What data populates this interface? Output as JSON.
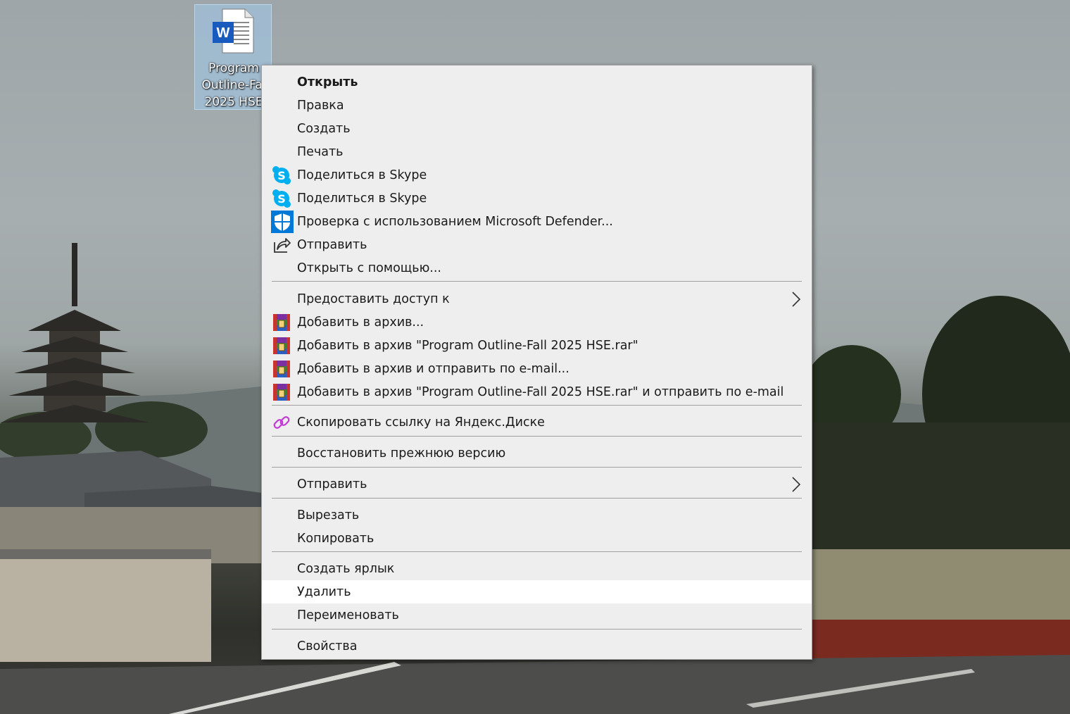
{
  "desktop_icon": {
    "label_lines": [
      "Program",
      "Outline-Fal",
      "2025 HSE"
    ],
    "type_icon": "word-document-icon"
  },
  "context_menu": {
    "items": [
      {
        "label": "Открыть",
        "icon": null,
        "bold": true
      },
      {
        "label": "Правка",
        "icon": null
      },
      {
        "label": "Создать",
        "icon": null
      },
      {
        "label": "Печать",
        "icon": null
      },
      {
        "label": "Поделиться в Skype",
        "icon": "skype-icon"
      },
      {
        "label": "Поделиться в Skype",
        "icon": "skype-icon"
      },
      {
        "label": "Проверка с использованием Microsoft Defender...",
        "icon": "defender-shield-icon"
      },
      {
        "label": "Отправить",
        "icon": "share-icon"
      },
      {
        "label": "Открыть с помощью...",
        "icon": null
      },
      {
        "label": "Предоставить доступ к",
        "icon": null,
        "submenu": true
      },
      {
        "label": "Добавить в архив...",
        "icon": "winrar-icon"
      },
      {
        "label": "Добавить в архив \"Program Outline-Fall 2025 HSE.rar\"",
        "icon": "winrar-icon"
      },
      {
        "label": "Добавить в архив и отправить по e-mail...",
        "icon": "winrar-icon"
      },
      {
        "label": "Добавить в архив \"Program Outline-Fall 2025 HSE.rar\" и отправить по e-mail",
        "icon": "winrar-icon"
      },
      {
        "label": "Скопировать ссылку на Яндекс.Диске",
        "icon": "link-icon"
      },
      {
        "label": "Восстановить прежнюю версию",
        "icon": null
      },
      {
        "label": "Отправить",
        "icon": null,
        "submenu": true
      },
      {
        "label": "Вырезать",
        "icon": null
      },
      {
        "label": "Копировать",
        "icon": null
      },
      {
        "label": "Создать ярлык",
        "icon": null
      },
      {
        "label": "Удалить",
        "icon": null,
        "highlighted": true
      },
      {
        "label": "Переименовать",
        "icon": null
      },
      {
        "label": "Свойства",
        "icon": null
      }
    ],
    "colors": {
      "menu_bg": "#eeeeee",
      "hover_bg": "#ffffff",
      "separator": "#a0a0a0",
      "skype": "#00aff0",
      "defender": "#0078d7",
      "link": "#c43ad6"
    }
  }
}
